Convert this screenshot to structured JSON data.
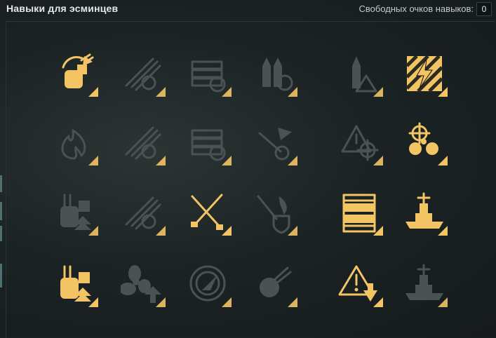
{
  "header": {
    "title": "Навыки для эсминцев",
    "points_label": "Свободных очков навыков:",
    "points_value": "0"
  },
  "colors": {
    "active": "#f2c464",
    "inactive": "#4a5253",
    "background": "#1c2324"
  },
  "skills": [
    {
      "row": 1,
      "col": 1,
      "icon": "turret-rotate-icon",
      "state": "active"
    },
    {
      "row": 1,
      "col": 2,
      "icon": "torpedo-reload-icon",
      "state": "inactive"
    },
    {
      "row": 1,
      "col": 3,
      "icon": "battery-reload-icon",
      "state": "inactive"
    },
    {
      "row": 1,
      "col": 4,
      "icon": "shells-reload-icon",
      "state": "inactive"
    },
    {
      "row": 1,
      "col": 5,
      "icon": "shell-warning-icon",
      "state": "inactive"
    },
    {
      "row": 1,
      "col": 6,
      "icon": "lightning-hazard-icon",
      "state": "active"
    },
    {
      "row": 2,
      "col": 1,
      "icon": "fire-icon",
      "state": "inactive"
    },
    {
      "row": 2,
      "col": 2,
      "icon": "torpedo-speed-icon",
      "state": "inactive"
    },
    {
      "row": 2,
      "col": 3,
      "icon": "consumable-timer-icon",
      "state": "inactive"
    },
    {
      "row": 2,
      "col": 4,
      "icon": "aa-rocket-icon",
      "state": "inactive"
    },
    {
      "row": 2,
      "col": 5,
      "icon": "warning-crosshair-icon",
      "state": "inactive"
    },
    {
      "row": 2,
      "col": 6,
      "icon": "helm-propellers-icon",
      "state": "active"
    },
    {
      "row": 3,
      "col": 1,
      "icon": "turret-upgrade-icon",
      "state": "inactive"
    },
    {
      "row": 3,
      "col": 2,
      "icon": "torpedo-refresh-icon",
      "state": "inactive"
    },
    {
      "row": 3,
      "col": 3,
      "icon": "crossed-torpedoes-icon",
      "state": "active"
    },
    {
      "row": 3,
      "col": 4,
      "icon": "fire-shield-icon",
      "state": "inactive"
    },
    {
      "row": 3,
      "col": 5,
      "icon": "extra-consumable-icon",
      "state": "active"
    },
    {
      "row": 3,
      "col": 6,
      "icon": "battleship-icon",
      "state": "active"
    },
    {
      "row": 4,
      "col": 1,
      "icon": "superintendent-icon",
      "state": "active"
    },
    {
      "row": 4,
      "col": 2,
      "icon": "propeller-up-icon",
      "state": "inactive"
    },
    {
      "row": 4,
      "col": 3,
      "icon": "radar-icon",
      "state": "inactive"
    },
    {
      "row": 4,
      "col": 4,
      "icon": "aa-gun-icon",
      "state": "inactive"
    },
    {
      "row": 4,
      "col": 5,
      "icon": "warning-down-icon",
      "state": "active"
    },
    {
      "row": 4,
      "col": 6,
      "icon": "ship-silhouette-icon",
      "state": "inactive"
    }
  ]
}
